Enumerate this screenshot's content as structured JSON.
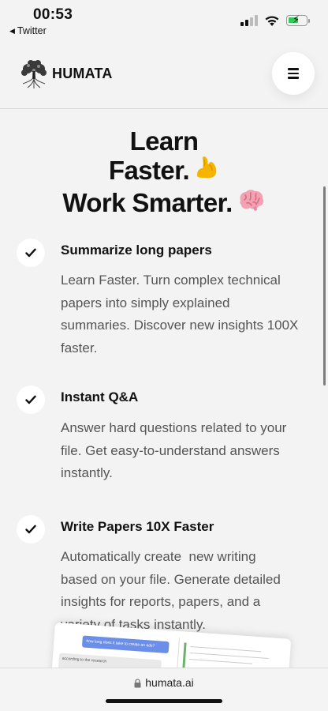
{
  "status_bar": {
    "time": "00:53",
    "back_app": "Twitter",
    "icons": [
      "back-triangle-icon",
      "cellular-signal-icon",
      "wifi-icon",
      "battery-charging-icon"
    ],
    "battery_color": "#34c759"
  },
  "header": {
    "logo_text": "HUMATA",
    "logo_icon": "tree-logo-icon",
    "menu_icon": "hamburger-menu-icon"
  },
  "hero": {
    "line1": "Learn",
    "line2": "Faster.",
    "line3": "Work Smarter.",
    "emoji_1": "flexed-biceps-icon",
    "emoji_2": "brain-icon"
  },
  "features": [
    {
      "icon": "checkmark-icon",
      "title": "Summarize long papers",
      "lines": [
        "Learn Faster. Turn complex technical",
        "papers into simply explained",
        "summaries. Discover new insights 100X",
        "faster."
      ]
    },
    {
      "icon": "checkmark-icon",
      "title": "Instant Q&A",
      "lines": [
        "Answer hard questions related to your",
        "file. Get easy-to-understand answers",
        "instantly."
      ]
    },
    {
      "icon": "checkmark-icon",
      "title": "Write Papers 10X Faster",
      "lines": [
        "Automatically create  new writing",
        "based on your file. Generate detailed",
        "insights for reports, papers, and a",
        "variety of tasks instantly."
      ]
    }
  ],
  "preview": {
    "chat_bubble": "how long does it take to create an ads?",
    "snippet": "according to the research"
  },
  "bottom_bar": {
    "url": "humata.ai",
    "lock_icon": "lock-icon"
  }
}
